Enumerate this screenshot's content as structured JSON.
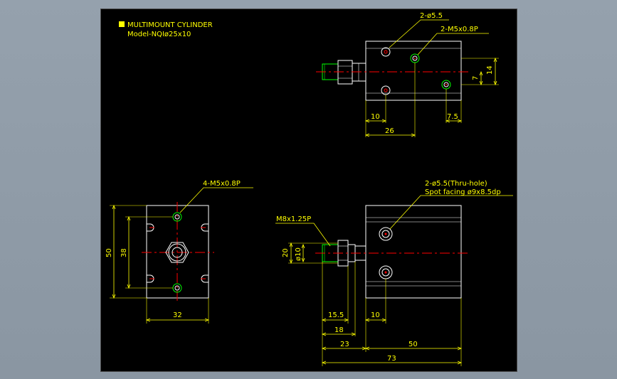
{
  "title": {
    "line1": "MULTIMOUNT CYLINDER",
    "line2": "Model-NQIø25x10"
  },
  "colors": {
    "background": "#000000",
    "outline": "#ffffff",
    "dimension": "#ffff00",
    "centerline": "#ff0000",
    "thread": "#00ff00",
    "frame": "#8e9aa6"
  },
  "top_view": {
    "callout_holes": "2-ø5.5",
    "callout_threads": "2-M5x0.8P",
    "dim_14": "14",
    "dim_7": "7",
    "dim_10": "10",
    "dim_7_5": "7.5",
    "dim_26": "26"
  },
  "end_view": {
    "callout_threads": "4-M5x0.8P",
    "dim_50": "50",
    "dim_38": "38",
    "dim_32": "32"
  },
  "side_view": {
    "callout_line1": "2-ø5.5(Thru-hole)",
    "callout_line2": "Spot facing  ø9x8.5dp",
    "callout_thread": "M8x1.25P",
    "dim_20": "20",
    "dim_phi10": "ø10",
    "dim_15_5": "15.5",
    "dim_10": "10",
    "dim_18": "18",
    "dim_23": "23",
    "dim_50": "50",
    "dim_73": "73"
  }
}
